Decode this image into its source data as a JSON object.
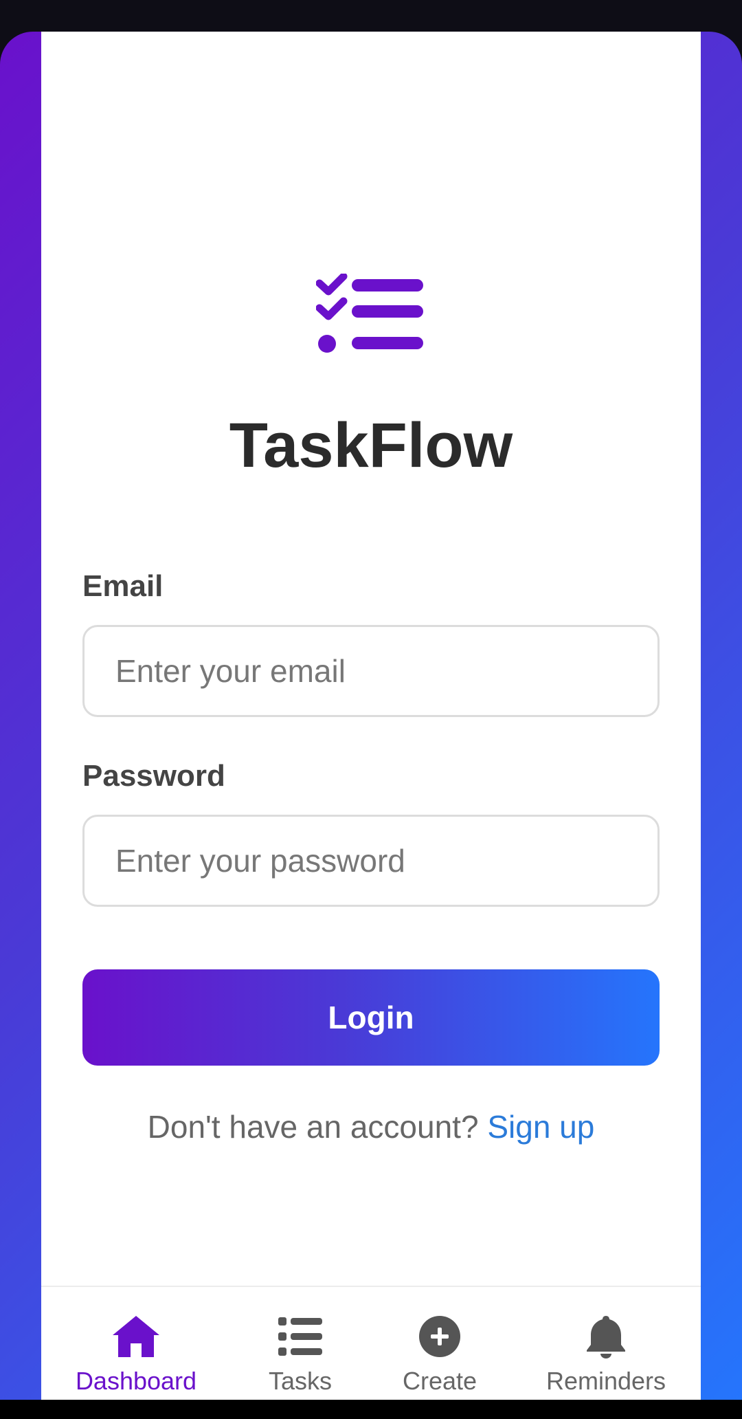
{
  "app": {
    "title": "TaskFlow"
  },
  "form": {
    "email_label": "Email",
    "email_placeholder": "Enter your email",
    "email_value": "",
    "password_label": "Password",
    "password_placeholder": "Enter your password",
    "password_value": "",
    "login_label": "Login",
    "signup_prompt": "Don't have an account?",
    "signup_link": "Sign up"
  },
  "bottom_nav": {
    "items": [
      {
        "label": "Dashboard",
        "icon": "home-icon",
        "active": true
      },
      {
        "label": "Tasks",
        "icon": "list-icon",
        "active": false
      },
      {
        "label": "Create",
        "icon": "plus-circle-icon",
        "active": false
      },
      {
        "label": "Reminders",
        "icon": "bell-icon",
        "active": false
      }
    ]
  },
  "colors": {
    "brand_purple": "#6a11cb",
    "brand_blue": "#2575fc",
    "link": "#2b7bd9",
    "nav_inactive": "#666666"
  }
}
